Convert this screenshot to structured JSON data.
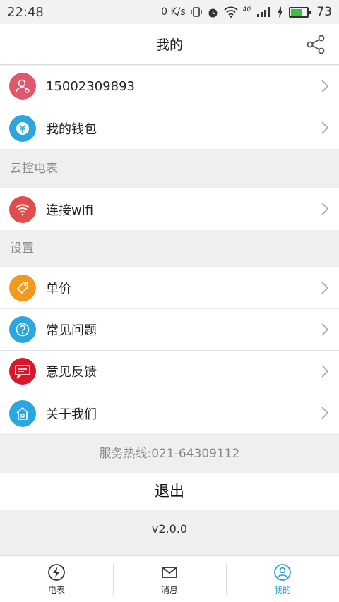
{
  "status": {
    "time": "22:48",
    "net_speed": "0 K/s",
    "network_type": "4G",
    "battery": "73",
    "battery_level": 0.73,
    "icons": [
      "vibrate-icon",
      "alarm-icon",
      "wifi-icon",
      "cell-signal-icon",
      "charging-icon",
      "battery-icon"
    ]
  },
  "header": {
    "title": "我的",
    "share_icon": "share-icon"
  },
  "account": {
    "items": [
      {
        "label": "15002309893",
        "icon": "user-icon",
        "color": "#e0566a"
      },
      {
        "label": "我的钱包",
        "icon": "wallet-yuan-icon",
        "color": "#2aa7df"
      }
    ]
  },
  "meter_section": {
    "title": "云控电表",
    "items": [
      {
        "label": "连接wifi",
        "icon": "wifi-icon",
        "color": "#e24c4c"
      }
    ]
  },
  "settings_section": {
    "title": "设置",
    "items": [
      {
        "label": "单价",
        "icon": "price-tag-icon",
        "color": "#f39a1e"
      },
      {
        "label": "常见问题",
        "icon": "question-icon",
        "color": "#2aa7df"
      },
      {
        "label": "意见反馈",
        "icon": "feedback-icon",
        "color": "#d8182a"
      },
      {
        "label": "关于我们",
        "icon": "home-icon",
        "color": "#2aa7df"
      }
    ]
  },
  "hotline": "服务热线:021-64309112",
  "logout_label": "退出",
  "version": "v2.0.0",
  "tabs": [
    {
      "label": "电表",
      "icon": "lightning-icon"
    },
    {
      "label": "消息",
      "icon": "mail-icon"
    },
    {
      "label": "我的",
      "icon": "profile-icon",
      "active": true
    }
  ],
  "colors": {
    "accent": "#2a9fd8",
    "battery_fill": "#3fbf3f"
  }
}
